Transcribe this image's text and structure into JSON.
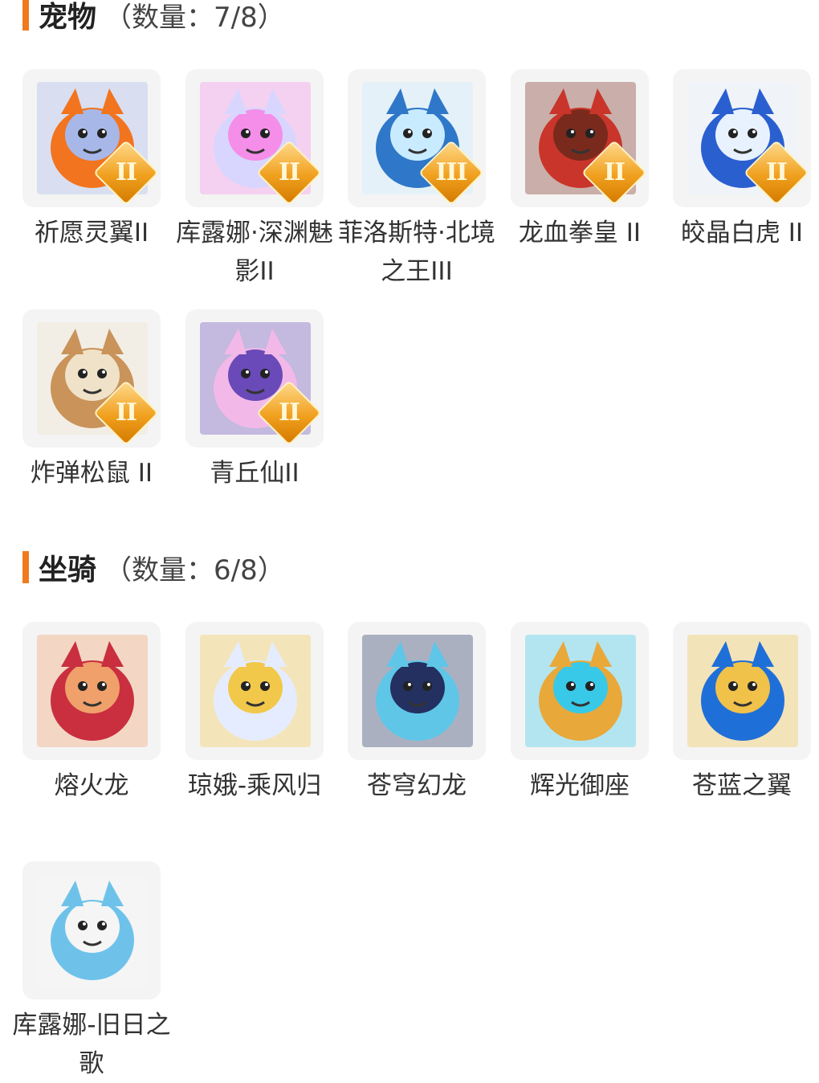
{
  "sections": [
    {
      "title": "宠物",
      "count": "（数量：7/8）",
      "accent": "#f07b1e",
      "items": [
        {
          "name": "祈愿灵翼II",
          "badge": "II",
          "icon": "phoenix-icon",
          "colors": [
            "#f2741f",
            "#a7b8e8"
          ]
        },
        {
          "name": "库露娜·深渊魅影II",
          "badge": "II",
          "icon": "sprite-girl-icon",
          "colors": [
            "#d8d6ff",
            "#f48ee8"
          ]
        },
        {
          "name": "菲洛斯特·北境之王III",
          "badge": "III",
          "icon": "frost-king-icon",
          "colors": [
            "#2f77c8",
            "#c9ebff"
          ]
        },
        {
          "name": "龙血拳皇 II",
          "badge": "II",
          "icon": "ram-beast-icon",
          "colors": [
            "#c9352a",
            "#7a2a1c"
          ]
        },
        {
          "name": "皎晶白虎 II",
          "badge": "II",
          "icon": "white-tiger-icon",
          "colors": [
            "#2a5fd0",
            "#e8f2ff"
          ]
        },
        {
          "name": "炸弹松鼠 II",
          "badge": "II",
          "icon": "squirrel-icon",
          "colors": [
            "#c9935a",
            "#efe2c8"
          ]
        },
        {
          "name": "青丘仙II",
          "badge": "II",
          "icon": "fox-fairy-icon",
          "colors": [
            "#f2b9e8",
            "#6a4ab8"
          ]
        }
      ]
    },
    {
      "title": "坐骑",
      "count": "（数量：6/8）",
      "accent": "#f07b1e",
      "items": [
        {
          "name": "熔火龙",
          "badge": "",
          "icon": "fire-dragon-icon",
          "colors": [
            "#c92f3f",
            "#f0a06a"
          ]
        },
        {
          "name": "琼娥-乘风归",
          "badge": "",
          "icon": "moon-maiden-icon",
          "colors": [
            "#e6ecff",
            "#f1c84a"
          ]
        },
        {
          "name": "苍穹幻龙",
          "badge": "",
          "icon": "sky-dragon-icon",
          "colors": [
            "#5fc6e8",
            "#233060"
          ]
        },
        {
          "name": "辉光御座",
          "badge": "",
          "icon": "radiant-throne-icon",
          "colors": [
            "#e8a83a",
            "#38c9e8"
          ]
        },
        {
          "name": "苍蓝之翼",
          "badge": "",
          "icon": "azure-wing-icon",
          "colors": [
            "#1f6fd8",
            "#f0c24a"
          ]
        },
        {
          "name": "库露娜-旧日之歌",
          "badge": "",
          "icon": "cloud-girl-icon",
          "colors": [
            "#6ec2ea",
            "#f5f5f5"
          ]
        }
      ]
    }
  ]
}
